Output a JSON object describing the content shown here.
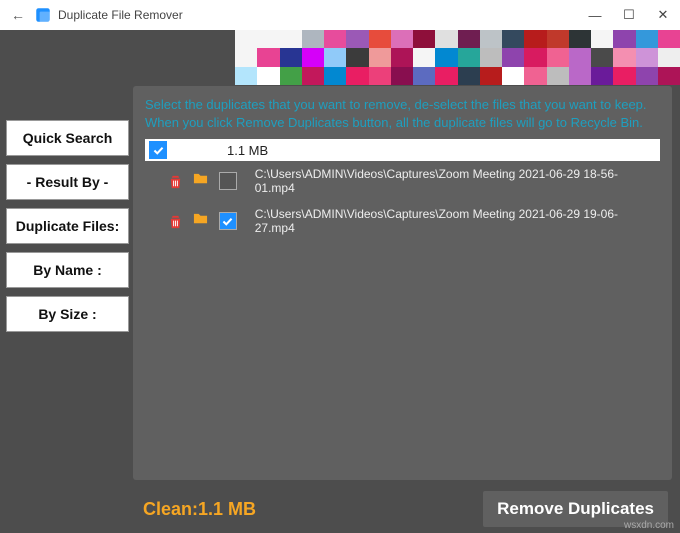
{
  "titlebar": {
    "back_glyph": "←",
    "app_title": "Duplicate File Remover",
    "min_glyph": "—",
    "max_glyph": "☐",
    "close_glyph": "✕"
  },
  "sidebar": {
    "quick_search": "Quick Search",
    "result_by": "- Result By -",
    "duplicate_files": "Duplicate Files:",
    "by_name": "By Name :",
    "by_size": "By Size :"
  },
  "panel": {
    "instructions": "Select the duplicates that you want to remove, de-select the files that you want to keep. When you click Remove Duplicates button, all the duplicate files will go to Recycle Bin.",
    "group": {
      "checked": true,
      "size_label": "1.1 MB"
    },
    "files": [
      {
        "checked": false,
        "path": "C:\\Users\\ADMIN\\Videos\\Captures\\Zoom Meeting 2021-06-29 18-56-01.mp4"
      },
      {
        "checked": true,
        "path": "C:\\Users\\ADMIN\\Videos\\Captures\\Zoom Meeting 2021-06-29 19-06-27.mp4"
      }
    ]
  },
  "footer": {
    "clean_label": "Clean:1.1 MB",
    "remove_label": "Remove Duplicates"
  },
  "watermark": "wsxdn.com",
  "pixel_colors": [
    "#f5f5f5",
    "#f5f5f5",
    "#f5f5f5",
    "#aeb6bf",
    "#e74c9c",
    "#9b59b6",
    "#e74c3c",
    "#dc6fb8",
    "#8e0f3a",
    "#e0e0e0",
    "#6f1e51",
    "#bdc3c7",
    "#34495e",
    "#b71c1c",
    "#c0392b",
    "#2d3436",
    "#f5f5f5",
    "#8e44ad",
    "#3498db",
    "#e84393",
    "#f5f5f5",
    "#e84393",
    "#283593",
    "#d500f9",
    "#90caf9",
    "#3b3b3b",
    "#ef9a9a",
    "#ad1457",
    "#f5f5f5",
    "#0288d1",
    "#26a69a",
    "#bdbdbd",
    "#8e44ad",
    "#d81b60",
    "#f06292",
    "#ba68c8",
    "#4a4a4a",
    "#f48fb1",
    "#ce93d8",
    "#eeeeee",
    "#b3e5fc",
    "#ffffff",
    "#43a047",
    "#c2185b",
    "#0288d1",
    "#e91e63",
    "#ec407a",
    "#880e4f",
    "#5c6bc0",
    "#e91e63",
    "#2c3e50",
    "#b71c1c",
    "#ffffff",
    "#f06292",
    "#bdbdbd",
    "#ba68c8",
    "#6a1b9a",
    "#e91e63",
    "#8e44ad",
    "#ad1457"
  ]
}
